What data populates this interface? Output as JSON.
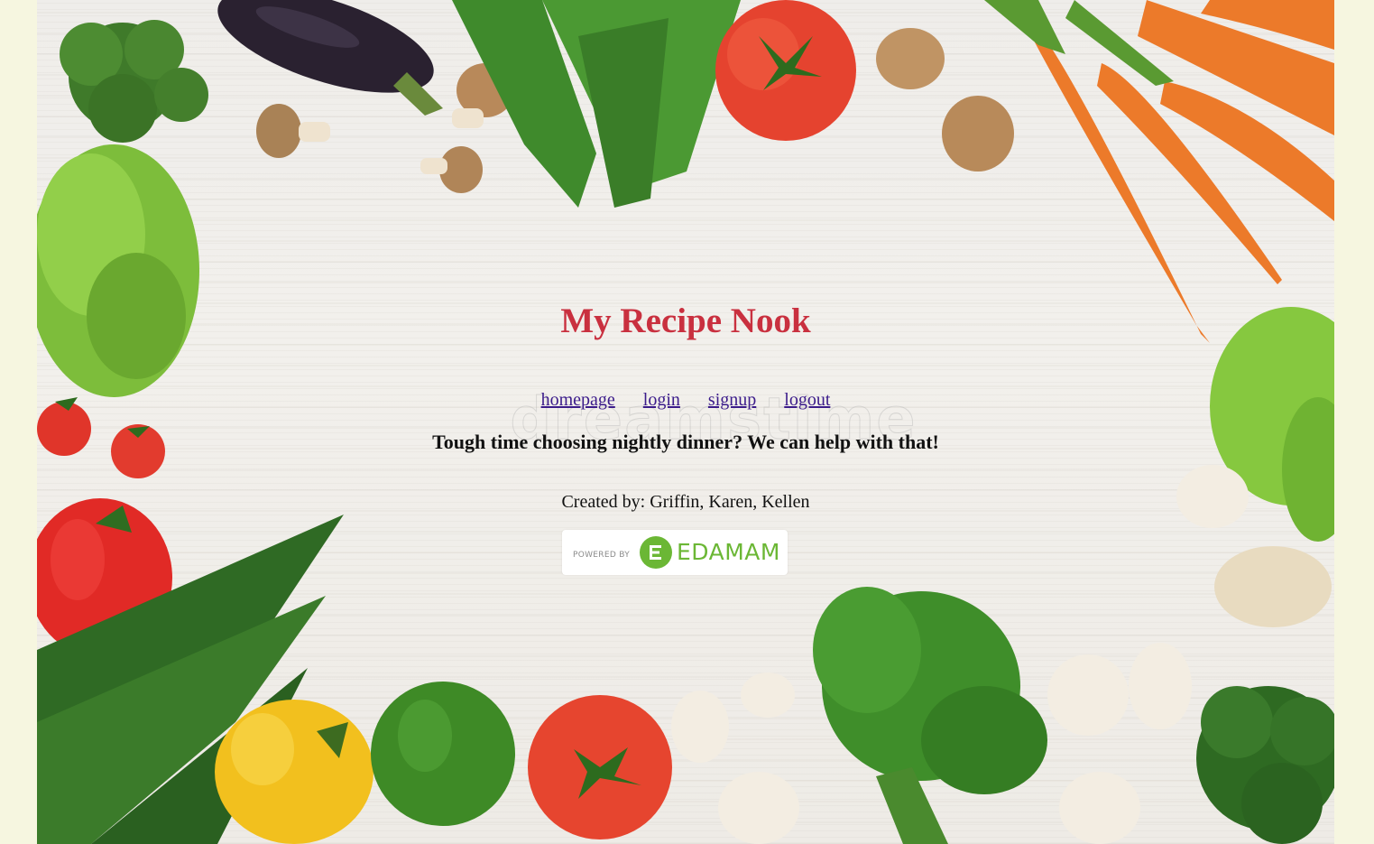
{
  "header": {
    "title": "My Recipe Nook"
  },
  "nav": {
    "items": [
      {
        "label": "homepage"
      },
      {
        "label": "login"
      },
      {
        "label": "signup"
      },
      {
        "label": "logout"
      }
    ]
  },
  "tagline": "Tough time choosing nightly dinner? We can help with that!",
  "credits": "Created by: Griffin, Karen, Kellen",
  "badge": {
    "powered_by": "POWERED BY",
    "brand": "EDAMAM"
  },
  "background": {
    "watermark": "dreamstime",
    "page_color": "#f6f6e0"
  },
  "colors": {
    "title": "#c9303f",
    "link": "#3b1b8a",
    "edamam_green": "#6bb735"
  }
}
